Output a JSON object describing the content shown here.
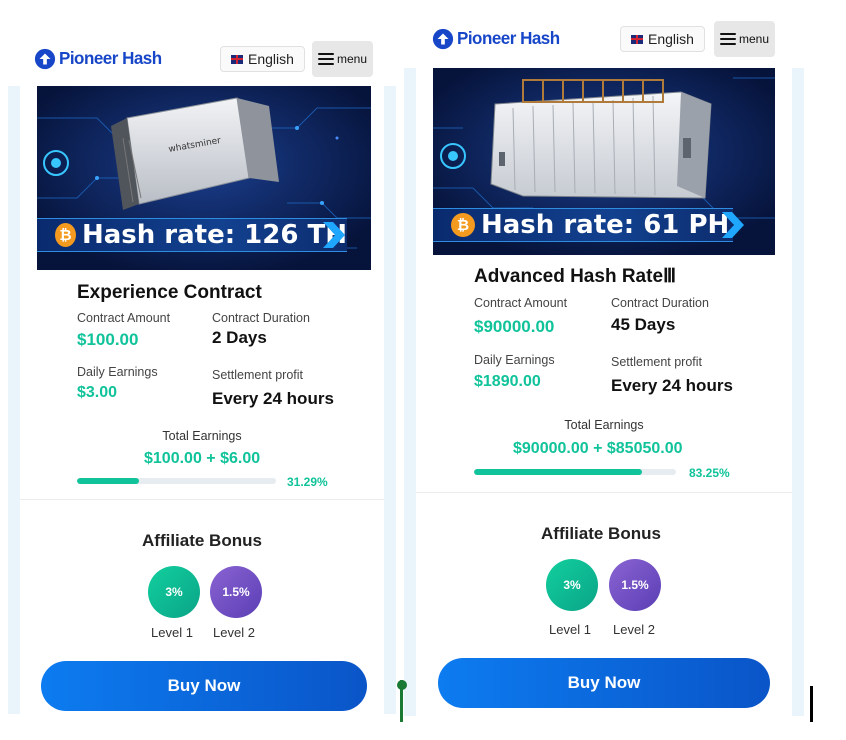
{
  "colors": {
    "accent_green": "#10c39a",
    "brand_blue": "#1746c8",
    "button_blue": "#0a6ae0"
  },
  "phones": [
    {
      "header": {
        "brand": "Pioneer Hash",
        "language": "English",
        "menu": "menu"
      },
      "banner": {
        "hash_rate": "Hash rate: 126 TH",
        "machine": "whatsminer"
      },
      "product": {
        "title": "Experience Contract",
        "contract_amount_label": "Contract Amount",
        "contract_amount": "$100.00",
        "contract_duration_label": "Contract Duration",
        "contract_duration": "2 Days",
        "daily_earnings_label": "Daily Earnings",
        "daily_earnings": "$3.00",
        "settlement_label": "Settlement profit",
        "settlement": "Every 24 hours",
        "total_earnings_label": "Total Earnings",
        "total_earnings": "$100.00 + $6.00",
        "progress_percent": 31.29,
        "progress_text": "31.29%"
      },
      "affiliate": {
        "title": "Affiliate Bonus",
        "levels": [
          {
            "rate": "3%",
            "label": "Level 1"
          },
          {
            "rate": "1.5%",
            "label": "Level 2"
          }
        ]
      },
      "buy_label": "Buy Now"
    },
    {
      "header": {
        "brand": "Pioneer Hash",
        "language": "English",
        "menu": "menu"
      },
      "banner": {
        "hash_rate": "Hash rate: 61 PH",
        "machine": "container"
      },
      "product": {
        "title": "Advanced Hash RateⅢ",
        "contract_amount_label": "Contract Amount",
        "contract_amount": "$90000.00",
        "contract_duration_label": "Contract Duration",
        "contract_duration": "45 Days",
        "daily_earnings_label": "Daily Earnings",
        "daily_earnings": "$1890.00",
        "settlement_label": "Settlement profit",
        "settlement": "Every 24 hours",
        "total_earnings_label": "Total Earnings",
        "total_earnings": "$90000.00 + $85050.00",
        "progress_percent": 83.25,
        "progress_text": "83.25%"
      },
      "affiliate": {
        "title": "Affiliate Bonus",
        "levels": [
          {
            "rate": "3%",
            "label": "Level 1"
          },
          {
            "rate": "1.5%",
            "label": "Level 2"
          }
        ]
      },
      "buy_label": "Buy Now"
    }
  ]
}
